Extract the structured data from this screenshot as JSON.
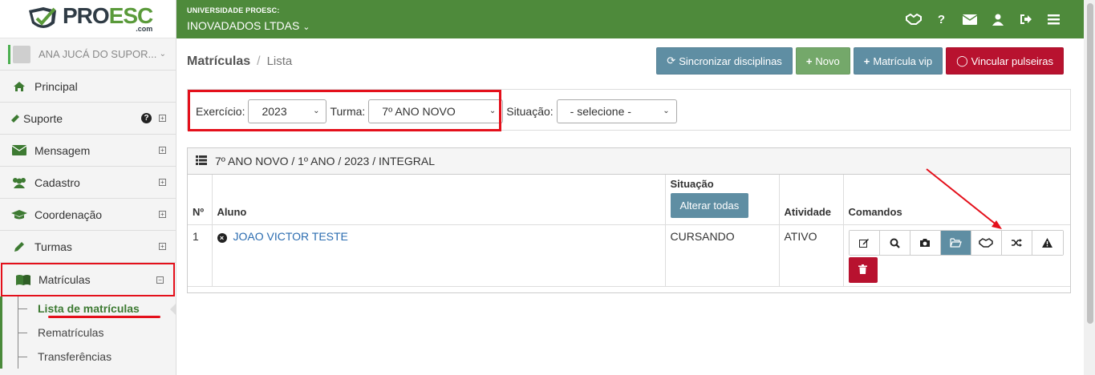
{
  "brand": {
    "main_a": "PRO",
    "main_b": "ESC",
    "sub": ".com"
  },
  "user": {
    "name": "ANA JUCÁ DO SUPOR..."
  },
  "sidebar": {
    "items": [
      {
        "label": "Principal",
        "icon": "home-icon"
      },
      {
        "label": "Suporte",
        "icon": "ticket-icon"
      },
      {
        "label": "Mensagem",
        "icon": "envelope-icon"
      },
      {
        "label": "Cadastro",
        "icon": "users-icon"
      },
      {
        "label": "Coordenação",
        "icon": "graduation-cap-icon"
      },
      {
        "label": "Turmas",
        "icon": "pencil-icon"
      },
      {
        "label": "Matrículas",
        "icon": "book-icon"
      }
    ],
    "sub_items": [
      {
        "label": "Lista de matrículas"
      },
      {
        "label": "Rematrículas"
      },
      {
        "label": "Transferências"
      }
    ]
  },
  "topbar": {
    "org_small": "UNIVERSIDADE PROESC:",
    "org_big": "INOVADADOS LTDAS"
  },
  "breadcrumb": {
    "title": "Matrículas",
    "separator": "/",
    "current": "Lista"
  },
  "actions": {
    "sync": "Sincronizar disciplinas",
    "novo": "Novo",
    "vip": "Matrícula vip",
    "pulseiras": "Vincular pulseiras"
  },
  "filters": {
    "exercicio_label": "Exercício:",
    "exercicio_value": "2023",
    "turma_label": "Turma:",
    "turma_value": "7º ANO NOVO",
    "situacao_label": "Situação:",
    "situacao_value": "- selecione -"
  },
  "panel": {
    "title": "7º ANO NOVO / 1º ANO / 2023 / INTEGRAL",
    "headers": {
      "num": "Nº",
      "aluno": "Aluno",
      "situacao": "Situação",
      "alterar": "Alterar todas",
      "atividade": "Atividade",
      "comandos": "Comandos"
    },
    "rows": [
      {
        "num": "1",
        "aluno": "JOAO VICTOR TESTE",
        "situacao": "CURSANDO",
        "atividade": "ATIVO"
      }
    ]
  },
  "colors": {
    "green": "#4e8a3b",
    "teal": "#5f8ea3",
    "red": "#b8122f",
    "highlight": "#e4101b"
  }
}
